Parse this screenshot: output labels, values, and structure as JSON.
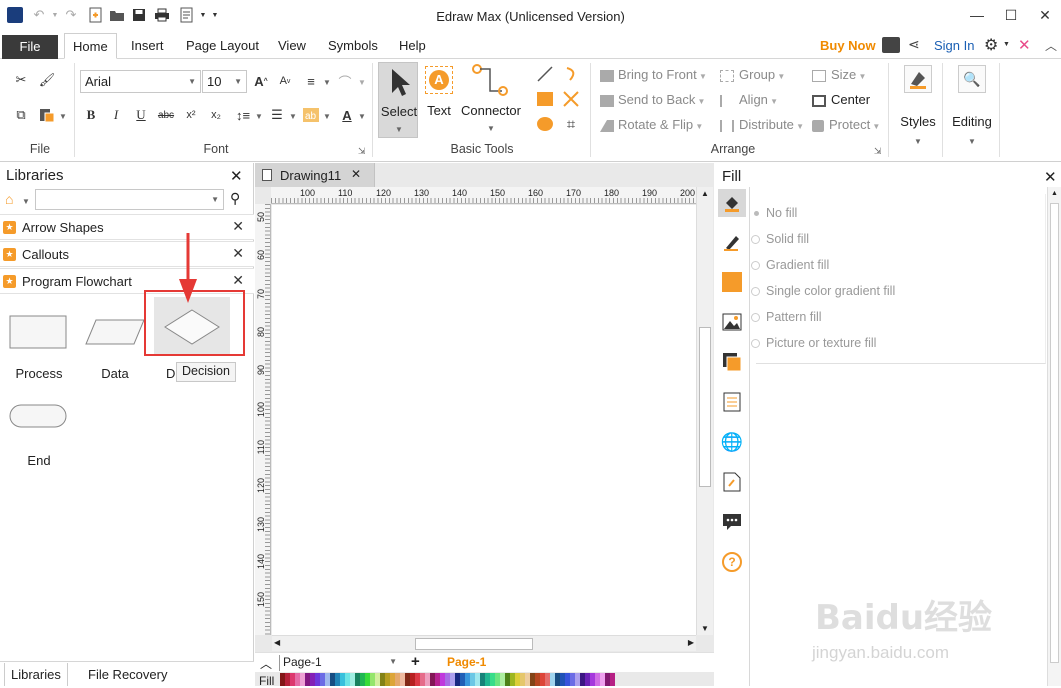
{
  "window": {
    "title": "Edraw Max (Unlicensed Version)"
  },
  "menu": {
    "file": "File",
    "tabs": [
      "Home",
      "Insert",
      "Page Layout",
      "View",
      "Symbols",
      "Help"
    ],
    "buy_now": "Buy Now",
    "sign_in": "Sign In"
  },
  "ribbon": {
    "groups": {
      "file": "File",
      "font": "Font",
      "basic_tools": "Basic Tools",
      "arrange": "Arrange"
    },
    "font_name": "Arial",
    "font_size": "10",
    "tools": {
      "select": "Select",
      "text": "Text",
      "connector": "Connector"
    },
    "arrange": {
      "bring_to_front": "Bring to Front",
      "send_to_back": "Send to Back",
      "rotate_flip": "Rotate & Flip",
      "group": "Group",
      "align": "Align",
      "distribute": "Distribute",
      "size": "Size",
      "center": "Center",
      "protect": "Protect"
    },
    "styles": "Styles",
    "editing": "Editing"
  },
  "libraries": {
    "title": "Libraries",
    "search_value": "",
    "sections": [
      "Arrow Shapes",
      "Callouts",
      "Program Flowchart"
    ],
    "shapes": [
      "Process",
      "Data",
      "D",
      "End"
    ],
    "tooltip": "Decision"
  },
  "bottom_tabs": {
    "libraries": "Libraries",
    "file_recovery": "File Recovery"
  },
  "document": {
    "tab": "Drawing11",
    "h_ruler": [
      "100",
      "110",
      "120",
      "130",
      "140",
      "150",
      "160",
      "170",
      "180",
      "190",
      "200"
    ],
    "v_ruler": [
      "50",
      "60",
      "70",
      "80",
      "90",
      "100",
      "110",
      "120",
      "130",
      "140",
      "150"
    ],
    "page_select": "Page-1",
    "page_tab": "Page-1",
    "fill_label": "Fill"
  },
  "fill_panel": {
    "title": "Fill",
    "options": [
      "No fill",
      "Solid fill",
      "Gradient fill",
      "Single color gradient fill",
      "Pattern fill",
      "Picture or texture fill"
    ]
  },
  "watermark": {
    "text": "Baidu经验",
    "sub": "jingyan.baidu.com"
  },
  "colors": {
    "accent": "#f59b2a",
    "file_tab": "#3a3a3a",
    "highlight": "#e53935",
    "link": "#1a5fb4"
  }
}
